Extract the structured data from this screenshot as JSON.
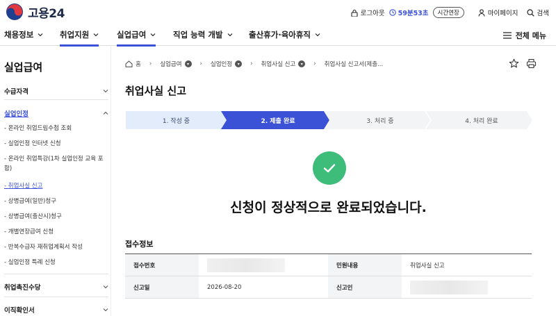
{
  "header": {
    "logo_text": "고용24",
    "logout_label": "로그아웃",
    "timer": "59분53초",
    "extend_label": "시간연장",
    "mypage_label": "마이페이지",
    "search_label": "검색"
  },
  "gnb": {
    "items": [
      "채용정보",
      "취업지원",
      "실업급여",
      "직업 능력 개발",
      "출산휴가·육아휴직"
    ],
    "all_menu": "전체 메뉴"
  },
  "sidebar": {
    "title": "실업급여",
    "sections": [
      "수급자격",
      "실업인정",
      "취업촉진수당",
      "이직확인서"
    ],
    "links": [
      "- 온라인 취업드림수첩 조회",
      "- 실업인정 인터넷 신청",
      "- 온라인 취업특강(1차 실업인정 교육 포함)",
      "- 취업사실 신고",
      "- 상병급여(일반)청구",
      "- 상병급여(출산시)청구",
      "- 개별연장급여 신청",
      "- 반복수급자 재취업계획서 작성",
      "- 실업인정 특례 신청"
    ]
  },
  "breadcrumb": {
    "home": "홈",
    "items": [
      "실업급여",
      "실업인정",
      "취업사실 신고",
      "취업사실 신고서(제출..."
    ]
  },
  "page_title": "취업사실 신고",
  "steps": [
    "1. 작성 중",
    "2. 제출 완료",
    "3. 처리 중",
    "4. 처리 완료"
  ],
  "completion_message": "신청이 정상적으로 완료되었습니다.",
  "receipt": {
    "title": "접수정보",
    "rows": [
      {
        "h1": "접수번호",
        "v1": "",
        "h2": "민원내용",
        "v2": "취업사실 신고"
      },
      {
        "h1": "신고일",
        "v1": "2026-08-20",
        "h2": "신고인",
        "v2": ""
      }
    ]
  },
  "colors": {
    "accent": "#3b52d6",
    "success": "#3dbc7a",
    "step_done": "#e3ecfa",
    "step_todo": "#f3f4f6"
  }
}
